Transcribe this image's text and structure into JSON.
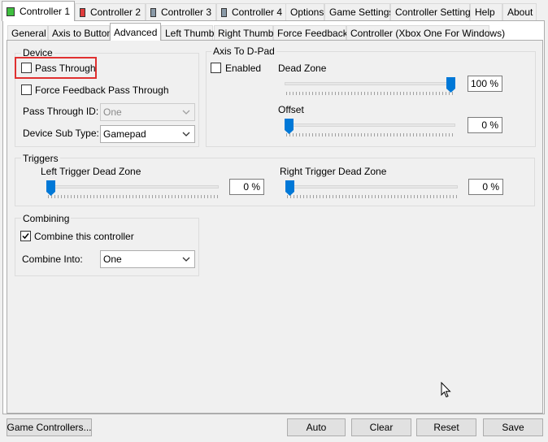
{
  "top_tabs": [
    {
      "label": "Controller 1",
      "icon": "green-square-icon",
      "color": "#3fbf3f"
    },
    {
      "label": "Controller 2",
      "icon": "red-square-icon",
      "color": "#e03c3c"
    },
    {
      "label": "Controller 3",
      "icon": "gray-square-icon",
      "color": "#8a9aa8"
    },
    {
      "label": "Controller 4",
      "icon": "gray-square-icon",
      "color": "#8a9aa8"
    },
    {
      "label": "Options"
    },
    {
      "label": "Game Settings"
    },
    {
      "label": "Controller Settings"
    },
    {
      "label": "Help"
    },
    {
      "label": "About"
    }
  ],
  "sub_tabs": [
    {
      "label": "General"
    },
    {
      "label": "Axis to Button"
    },
    {
      "label": "Advanced"
    },
    {
      "label": "Left Thumb"
    },
    {
      "label": "Right Thumb"
    },
    {
      "label": "Force Feedback"
    },
    {
      "label": "Controller (Xbox One For Windows)"
    }
  ],
  "device": {
    "legend": "Device",
    "pass_through": "Pass Through",
    "force_feedback_pass_through": "Force Feedback Pass Through",
    "pass_through_id_label": "Pass Through ID:",
    "pass_through_id_value": "One",
    "device_sub_type_label": "Device Sub Type:",
    "device_sub_type_value": "Gamepad"
  },
  "axis_to_dpad": {
    "legend": "Axis To D-Pad",
    "enabled": "Enabled",
    "dead_zone_label": "Dead Zone",
    "dead_zone_value": "100 %",
    "dead_zone_level": 1.0,
    "offset_label": "Offset",
    "offset_value": "0 %",
    "offset_level": 0.0
  },
  "triggers": {
    "legend": "Triggers",
    "left_label": "Left Trigger Dead Zone",
    "left_value": "0 %",
    "left_level": 0.0,
    "right_label": "Right Trigger Dead Zone",
    "right_value": "0 %",
    "right_level": 0.0
  },
  "combining": {
    "legend": "Combining",
    "combine_label": "Combine this controller",
    "combine_checked": true,
    "combine_into_label": "Combine Into:",
    "combine_into_value": "One"
  },
  "buttons": {
    "game_controllers": "Game Controllers...",
    "auto": "Auto",
    "clear": "Clear",
    "reset": "Reset",
    "save": "Save"
  },
  "colors": {
    "slider_thumb": "#0078d7",
    "highlight": "#e03030"
  }
}
